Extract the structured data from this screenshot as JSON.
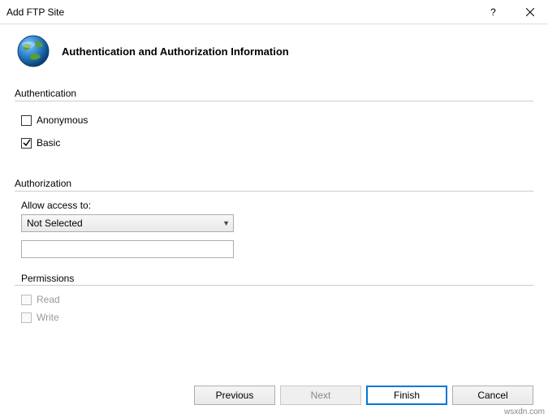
{
  "titlebar": {
    "title": "Add FTP Site",
    "help": "?",
    "close": "×"
  },
  "header": {
    "title": "Authentication and Authorization Information"
  },
  "authentication": {
    "group_label": "Authentication",
    "anonymous": {
      "label": "Anonymous",
      "checked": false
    },
    "basic": {
      "label": "Basic",
      "checked": true
    }
  },
  "authorization": {
    "group_label": "Authorization",
    "allow_label": "Allow access to:",
    "select_value": "Not Selected",
    "textbox_value": "",
    "permissions_label": "Permissions",
    "read": {
      "label": "Read",
      "checked": false,
      "enabled": false
    },
    "write": {
      "label": "Write",
      "checked": false,
      "enabled": false
    }
  },
  "footer": {
    "previous": "Previous",
    "next": "Next",
    "finish": "Finish",
    "cancel": "Cancel"
  },
  "watermark": "wsxdn.com"
}
